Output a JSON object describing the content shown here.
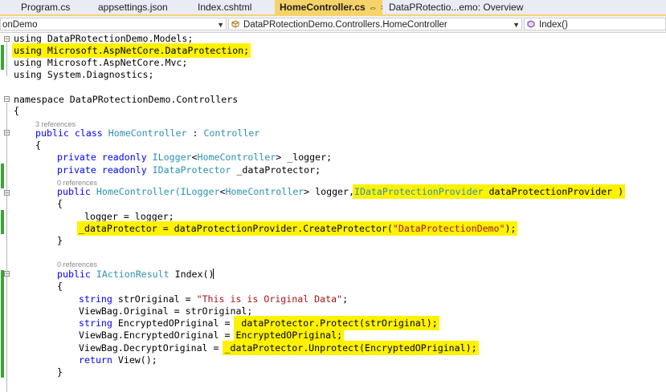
{
  "tabs": [
    {
      "label": "Program.cs",
      "active": false
    },
    {
      "label": "appsettings.json",
      "active": false
    },
    {
      "label": "Index.cshtml",
      "active": false
    },
    {
      "label": "HomeController.cs",
      "active": true
    },
    {
      "label": "DataPRotectio...emo: Overview",
      "active": false
    }
  ],
  "tab_pin_glyph": "⇔",
  "tab_close_glyph": "×",
  "nav": {
    "project": "onDemo",
    "class": "DataPRotectionDemo.Controllers.HomeController",
    "member": "Index()"
  },
  "colors": {
    "highlight": "#fff200",
    "keyword": "#0000ff",
    "type": "#2b91af",
    "string": "#a31515",
    "change_bar": "#3aa33a",
    "active_tab": "#f6d36a"
  },
  "code": {
    "using1": "using DataPRotectionDemo.Models;",
    "using2": "using Microsoft.AspNetCore.DataProtection;",
    "using3": "using Microsoft.AspNetCore.Mvc;",
    "using4": "using System.Diagnostics;",
    "ns": "namespace DataPRotectionDemo.Controllers",
    "brace_open": "{",
    "brace_close": "}",
    "refs_class": "3 references",
    "class_decl": {
      "public": "public",
      "class": "class",
      "name": "HomeController",
      "sep": " : ",
      "base": "Controller"
    },
    "field1": {
      "mods": "private readonly ",
      "type": "ILogger",
      "lt": "<",
      "arg": "HomeController",
      "gt": ">",
      "name": " _logger;"
    },
    "field2": {
      "mods": "private readonly ",
      "type": "IDataProtector",
      "name": " _dataProtector;"
    },
    "refs_ctor": "0 references",
    "ctor": {
      "public": "public ",
      "name": "HomeController(",
      "type1": "ILogger",
      "lt": "<",
      "arg": "HomeController",
      "gt": ">",
      "p1": " logger,",
      "type2": "IDataProtectionProvider",
      "p2": " dataProtectionProvider )"
    },
    "assign1": "_logger = logger;",
    "assign2": {
      "pre": "_dataProtector = dataProtectionProvider.CreateProtector(",
      "str": "\"DataProtectionDemo\"",
      "post": ");"
    },
    "refs_index": "0 references",
    "index_decl": {
      "public": "public ",
      "type": "IActionResult",
      "name": " Index()"
    },
    "l1": {
      "kw": "string",
      "mid": " strOriginal = ",
      "str": "\"This is is Original Data\"",
      "end": ";"
    },
    "l2": "ViewBag.Original = strOriginal;",
    "l3": {
      "kw": "string",
      "mid": " EncryptedOPriginal = ",
      "hl": "_dataProtector.Protect(strOriginal);"
    },
    "l4": {
      "pre": "ViewBag.EncryptedOriginal = ",
      "hl": "EncryptedOPriginal;"
    },
    "l5": {
      "pre": "ViewBag.DecryptOriginal = ",
      "hl": "_dataProtector.Unprotect(EncryptedOPriginal);"
    },
    "l6": {
      "kw": "return",
      "rest": " View();"
    }
  }
}
